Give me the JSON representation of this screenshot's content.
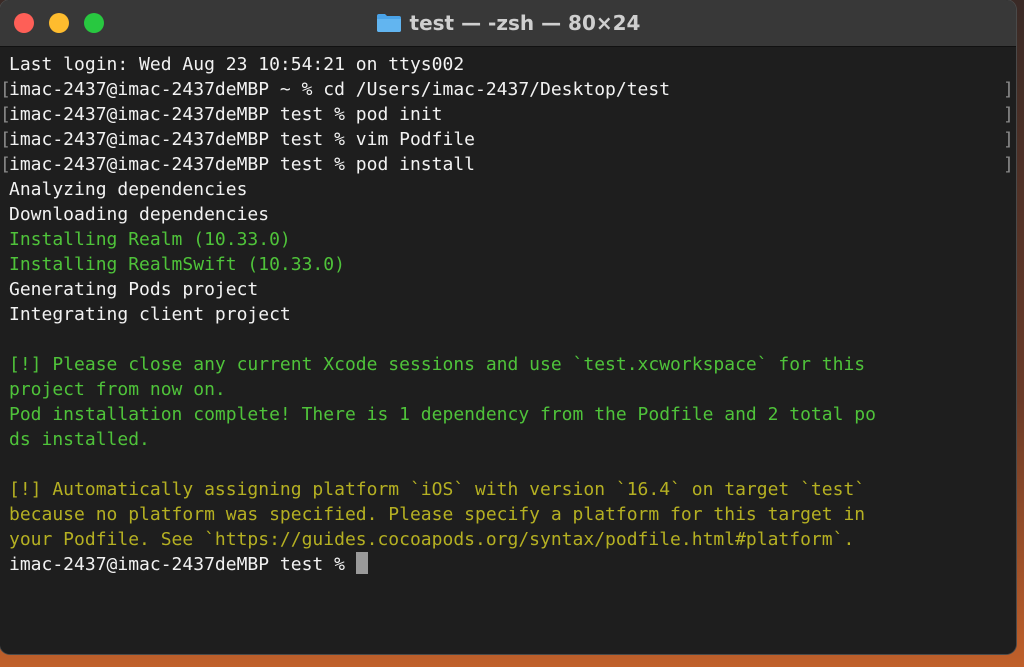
{
  "window": {
    "title": "test — -zsh — 80×24",
    "icon": "folder-icon"
  },
  "terminal": {
    "lines": [
      {
        "text": "Last login: Wed Aug 23 10:54:21 on ttys002",
        "color": "#f2f2f2",
        "marked": false
      },
      {
        "text": "imac-2437@imac-2437deMBP ~ % cd /Users/imac-2437/Desktop/test",
        "color": "#f2f2f2",
        "marked": true
      },
      {
        "text": "imac-2437@imac-2437deMBP test % pod init",
        "color": "#f2f2f2",
        "marked": true
      },
      {
        "text": "imac-2437@imac-2437deMBP test % vim Podfile",
        "color": "#f2f2f2",
        "marked": true
      },
      {
        "text": "imac-2437@imac-2437deMBP test % pod install",
        "color": "#f2f2f2",
        "marked": true
      },
      {
        "text": "Analyzing dependencies",
        "color": "#f2f2f2",
        "marked": false
      },
      {
        "text": "Downloading dependencies",
        "color": "#f2f2f2",
        "marked": false
      },
      {
        "text": "Installing Realm (10.33.0)",
        "color": "#4fc33a",
        "marked": false
      },
      {
        "text": "Installing RealmSwift (10.33.0)",
        "color": "#4fc33a",
        "marked": false
      },
      {
        "text": "Generating Pods project",
        "color": "#f2f2f2",
        "marked": false
      },
      {
        "text": "Integrating client project",
        "color": "#f2f2f2",
        "marked": false
      },
      {
        "text": "",
        "color": "#f2f2f2",
        "marked": false
      },
      {
        "text": "[!] Please close any current Xcode sessions and use `test.xcworkspace` for this",
        "color": "#4fc33a",
        "marked": false
      },
      {
        "text": "project from now on.",
        "color": "#4fc33a",
        "marked": false
      },
      {
        "text": "Pod installation complete! There is 1 dependency from the Podfile and 2 total po",
        "color": "#4fc33a",
        "marked": false
      },
      {
        "text": "ds installed.",
        "color": "#4fc33a",
        "marked": false
      },
      {
        "text": "",
        "color": "#f2f2f2",
        "marked": false
      },
      {
        "text": "[!] Automatically assigning platform `iOS` with version `16.4` on target `test`",
        "color": "#b5b022",
        "marked": false
      },
      {
        "text": "because no platform was specified. Please specify a platform for this target in",
        "color": "#b5b022",
        "marked": false
      },
      {
        "text": "your Podfile. See `https://guides.cocoapods.org/syntax/podfile.html#platform`.",
        "color": "#b5b022",
        "marked": false
      },
      {
        "text": "imac-2437@imac-2437deMBP test % ",
        "color": "#f2f2f2",
        "marked": false,
        "cursor": true
      }
    ],
    "mark_left": "[",
    "mark_right": "]"
  }
}
